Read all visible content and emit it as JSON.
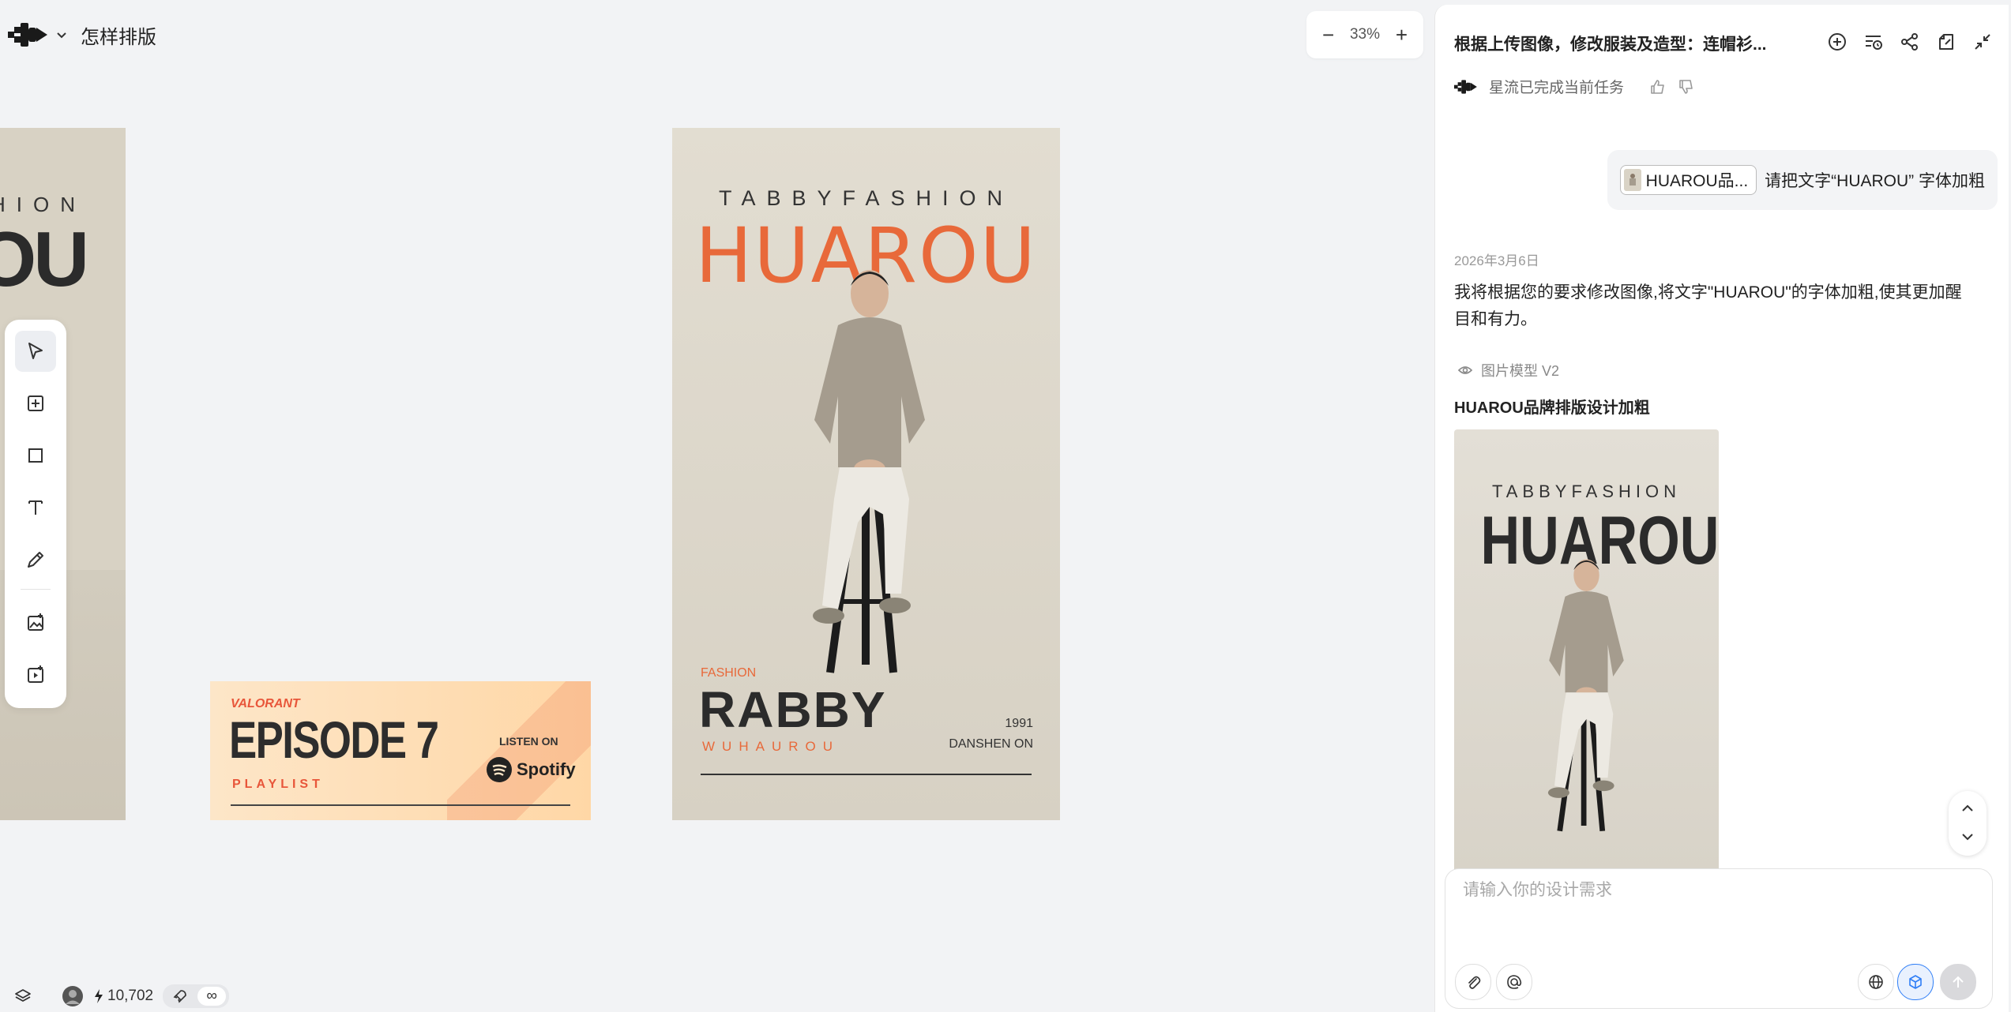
{
  "brand": {
    "title": "怎样排版",
    "logo_icon": "starflow-logo-icon"
  },
  "zoom": {
    "minus": "−",
    "level": "33%",
    "plus": "+"
  },
  "toolbar": {
    "tools": [
      "select-pointer-icon",
      "add-frame-icon",
      "rectangle-icon",
      "text-icon",
      "pen-icon",
      "image-generate-icon",
      "video-generate-icon"
    ]
  },
  "posters": {
    "left": {
      "top_text": "HION",
      "big_text": "OU"
    },
    "main": {
      "top_text": "TABBYFASHION",
      "big_text": "HUAROU",
      "fashion": "FASHION",
      "rabby": "RABBY",
      "sub": "WUHAUROU",
      "year": "1991",
      "tag": "DANSHEN ON"
    },
    "banner": {
      "brand": "VALORANT",
      "title": "EPISODE 7",
      "sub": "PLAYLIST",
      "listen": "LISTEN ON",
      "spotify": "Spotify"
    }
  },
  "bottom": {
    "credits": "10,702",
    "infinity": "∞"
  },
  "panel": {
    "title": "根据上传图像，修改服装及造型：连帽衫...",
    "status": "星流已完成当前任务",
    "user_message": {
      "chip": "HUAROU品...",
      "text": "请把文字“HUAROU” 字体加粗"
    },
    "date": "2026年3月6日",
    "reply": "我将根据您的要求修改图像,将文字\"HUAROU\"的字体加粗,使其更加醒目和有力。",
    "model": "图片模型 V2",
    "result_title": "HUAROU品牌排版设计加粗",
    "result_image": {
      "top_text": "TABBYFASHION",
      "big_text": "HUAROU"
    },
    "input_placeholder": "请输入你的设计需求"
  },
  "colors": {
    "accent_orange": "#e8693a",
    "dark_text": "#2b2b2b",
    "accent_blue": "#2f7ef6"
  }
}
